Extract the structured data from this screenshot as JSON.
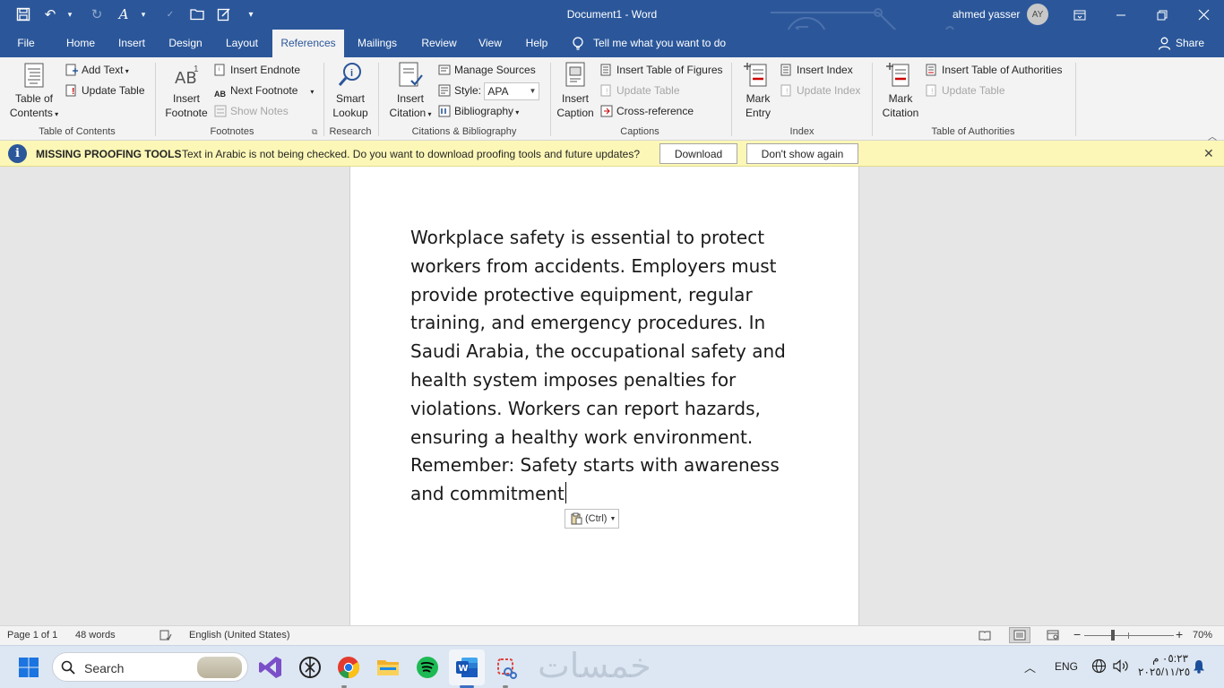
{
  "window": {
    "title": "Document1  -  Word",
    "user_name": "ahmed yasser",
    "avatar_initials": "AY"
  },
  "tabs": [
    {
      "label": "File"
    },
    {
      "label": "Home"
    },
    {
      "label": "Insert"
    },
    {
      "label": "Design"
    },
    {
      "label": "Layout"
    },
    {
      "label": "References",
      "active": true
    },
    {
      "label": "Mailings"
    },
    {
      "label": "Review"
    },
    {
      "label": "View"
    },
    {
      "label": "Help"
    }
  ],
  "tell_me": "Tell me what you want to do",
  "share": "Share",
  "ribbon": {
    "toc": {
      "big_label_1": "Table of",
      "big_label_2": "Contents",
      "add_text": "Add Text",
      "update_table": "Update Table",
      "group": "Table of Contents"
    },
    "footnotes": {
      "big_label_1": "Insert",
      "big_label_2": "Footnote",
      "insert_endnote": "Insert Endnote",
      "next_footnote": "Next Footnote",
      "show_notes": "Show Notes",
      "group": "Footnotes"
    },
    "research": {
      "big_label_1": "Smart",
      "big_label_2": "Lookup",
      "group": "Research"
    },
    "citations": {
      "big_label_1": "Insert",
      "big_label_2": "Citation",
      "manage_sources": "Manage Sources",
      "style_label": "Style:",
      "style_value": "APA",
      "bibliography": "Bibliography",
      "group": "Citations & Bibliography"
    },
    "captions": {
      "big_label_1": "Insert",
      "big_label_2": "Caption",
      "insert_table_of_figures": "Insert Table of Figures",
      "update_table": "Update Table",
      "cross_reference": "Cross-reference",
      "group": "Captions"
    },
    "index": {
      "big_label_1": "Mark",
      "big_label_2": "Entry",
      "insert_index": "Insert Index",
      "update_index": "Update Index",
      "group": "Index"
    },
    "authorities": {
      "big_label_1": "Mark",
      "big_label_2": "Citation",
      "insert_table": "Insert Table of Authorities",
      "update_table": "Update Table",
      "group": "Table of Authorities"
    }
  },
  "message_bar": {
    "title": "MISSING PROOFING TOOLS",
    "text": "Text in Arabic is not being checked. Do you want to download proofing tools and future updates?",
    "download": "Download",
    "dont_show": "Don't show again"
  },
  "document": {
    "text": "Workplace safety is essential to protect workers from accidents. Employers must provide protective equipment, regular training, and emergency procedures. In Saudi Arabia, the occupational safety and health system imposes penalties for violations. Workers can report hazards, ensuring a healthy work environment. Remember: Safety starts with awareness and commitment",
    "paste_options": "(Ctrl)"
  },
  "status": {
    "page": "Page 1 of 1",
    "words": "48 words",
    "language": "English (United States)",
    "zoom": "70%"
  },
  "taskbar": {
    "search_placeholder": "Search",
    "lang": "ENG",
    "time": "٠٥:٢٣ م",
    "date": "٢٠٢٥/١١/٢٥",
    "watermark": "خمسات"
  },
  "colors": {
    "word_blue": "#2b579a",
    "ribbon_bg": "#f3f3f3",
    "message_bar_bg": "#fcf7b6"
  }
}
